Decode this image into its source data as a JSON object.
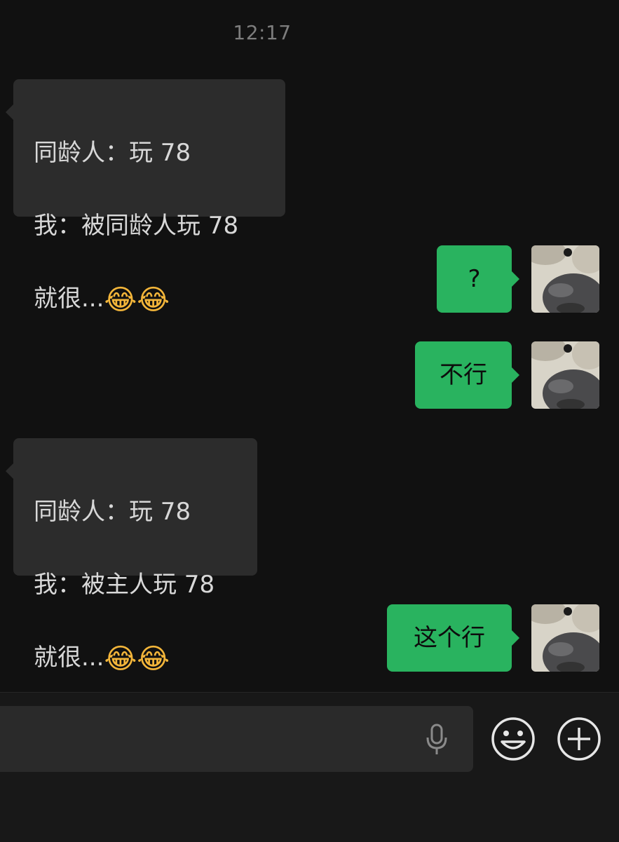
{
  "chat": {
    "timestamp": "12:17",
    "messages": [
      {
        "side": "in",
        "lines": [
          "同龄人：玩 78",
          "我：被同龄人玩 78"
        ],
        "last_line_text": "就很...",
        "emoji": [
          "face-with-tears-of-joy-icon",
          "face-with-tears-of-joy-icon"
        ]
      },
      {
        "side": "out",
        "text": "?"
      },
      {
        "side": "out",
        "text": "不行"
      },
      {
        "side": "in",
        "lines": [
          "同龄人：玩 78",
          "我：被主人玩 78"
        ],
        "last_line_text": "就很...",
        "emoji": [
          "face-with-tears-of-joy-icon",
          "face-with-tears-of-joy-icon"
        ]
      },
      {
        "side": "out",
        "text": "这个行"
      }
    ]
  },
  "input": {
    "value": "",
    "placeholder": ""
  },
  "colors": {
    "background": "#111111",
    "incoming_bubble": "#2c2c2c",
    "outgoing_bubble": "#29b35f",
    "input_bar": "#181818"
  },
  "icons": {
    "mic": "microphone-icon",
    "emoji": "emoji-face-icon",
    "more": "plus-circle-icon",
    "reaction": "😂"
  }
}
